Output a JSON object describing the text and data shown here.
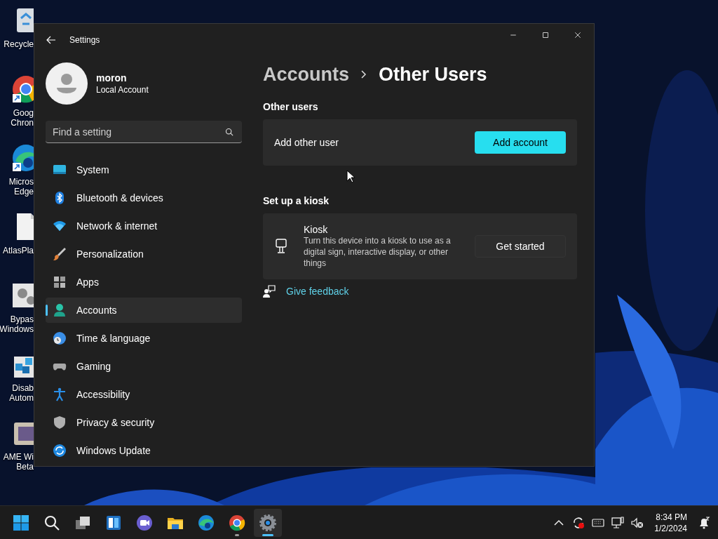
{
  "desktop_icons": [
    {
      "kind": "recycle",
      "label": "Recycle"
    },
    {
      "kind": "chrome",
      "label": "Goog\nChron",
      "shortcut": true
    },
    {
      "kind": "edge",
      "label": "Micros\nEdge",
      "shortcut": true
    },
    {
      "kind": "file",
      "label": "AtlasPla"
    },
    {
      "kind": "gears",
      "label": "Bypas\nWindows"
    },
    {
      "kind": "cubes",
      "label": "Disab\nAutom"
    },
    {
      "kind": "box",
      "label": "AME Wi\nBeta"
    }
  ],
  "window": {
    "title": "Settings",
    "profile": {
      "name": "moron",
      "account_type": "Local Account"
    },
    "search": {
      "placeholder": "Find a setting"
    },
    "nav_items": [
      {
        "kind": "system",
        "label": "System",
        "selected": false
      },
      {
        "kind": "bluetooth",
        "label": "Bluetooth & devices",
        "selected": false
      },
      {
        "kind": "network",
        "label": "Network & internet",
        "selected": false
      },
      {
        "kind": "personalization",
        "label": "Personalization",
        "selected": false
      },
      {
        "kind": "apps",
        "label": "Apps",
        "selected": false
      },
      {
        "kind": "accounts",
        "label": "Accounts",
        "selected": true
      },
      {
        "kind": "time",
        "label": "Time & language",
        "selected": false
      },
      {
        "kind": "gaming",
        "label": "Gaming",
        "selected": false
      },
      {
        "kind": "accessibility",
        "label": "Accessibility",
        "selected": false
      },
      {
        "kind": "privacy",
        "label": "Privacy & security",
        "selected": false
      },
      {
        "kind": "update",
        "label": "Windows Update",
        "selected": false
      }
    ],
    "breadcrumb": [
      "Accounts",
      "Other Users"
    ],
    "sections": [
      {
        "heading": "Other users",
        "cards": [
          {
            "title": "Add other user",
            "button": {
              "label": "Add account",
              "primary": true
            }
          }
        ]
      },
      {
        "heading": "Set up a kiosk",
        "cards": [
          {
            "kind": "kiosk",
            "title": "Kiosk",
            "description": "Turn this device into a kiosk to use as a digital sign, interactive display, or other things",
            "button": {
              "label": "Get started",
              "primary": false
            }
          }
        ]
      }
    ],
    "feedback_link": "Give feedback"
  },
  "taskbar": {
    "apps": [
      {
        "kind": "start",
        "selected": false,
        "running": false
      },
      {
        "kind": "search",
        "selected": false,
        "running": false
      },
      {
        "kind": "taskview",
        "selected": false,
        "running": false
      },
      {
        "kind": "widgets",
        "selected": false,
        "running": false
      },
      {
        "kind": "chat",
        "selected": false,
        "running": false
      },
      {
        "kind": "explorer",
        "selected": false,
        "running": false
      },
      {
        "kind": "edge",
        "selected": false,
        "running": false
      },
      {
        "kind": "chrome",
        "selected": false,
        "running": true
      },
      {
        "kind": "settings",
        "selected": true,
        "running": true
      }
    ],
    "tray": {
      "time": "8:34 PM",
      "date": "1/2/2024"
    }
  }
}
